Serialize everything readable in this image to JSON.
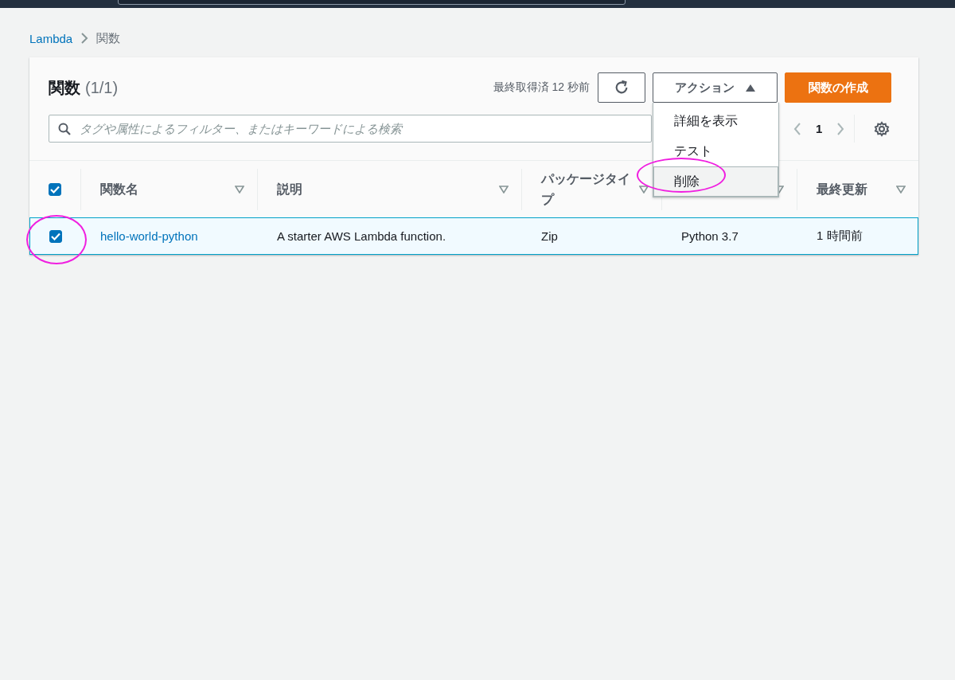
{
  "breadcrumb": [
    {
      "label": "Lambda",
      "kind": "link"
    },
    {
      "label": "関数",
      "kind": "current"
    }
  ],
  "panel": {
    "title": "関数",
    "count": "(1/1)",
    "last_fetched": "最終取得済 12 秒前",
    "actions_button": {
      "label": "アクション",
      "expanded": true
    },
    "create_button": "関数の作成"
  },
  "search": {
    "placeholder": "タグや属性によるフィルター、またはキーワードによる検索"
  },
  "pagination": {
    "page": "1"
  },
  "actions_menu": [
    {
      "label": "詳細を表示",
      "selected": false,
      "annotated": false
    },
    {
      "label": "テスト",
      "selected": false,
      "annotated": false
    },
    {
      "label": "削除",
      "selected": true,
      "annotated": true
    }
  ],
  "table": {
    "select_all_checked": true,
    "columns": [
      {
        "label": "関数名"
      },
      {
        "label": "説明"
      },
      {
        "label": "パッケージタイプ"
      },
      {},
      {
        "label": "最終更新"
      }
    ],
    "rows": [
      {
        "checked": true,
        "selected": true,
        "annotated": true,
        "cells": [
          "hello-world-python",
          "A starter AWS Lambda function.",
          "Zip",
          "Python 3.7",
          "1 時間前"
        ]
      }
    ]
  }
}
